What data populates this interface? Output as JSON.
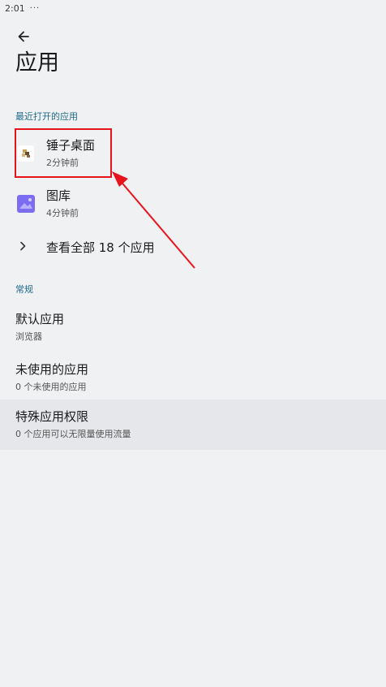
{
  "status_bar": {
    "time": "2:01",
    "more": "···"
  },
  "page": {
    "title": "应用"
  },
  "recent": {
    "header": "最近打开的应用",
    "apps": [
      {
        "name": "锤子桌面",
        "subtitle": "2分钟前",
        "icon": "hammer-launcher-icon"
      },
      {
        "name": "图库",
        "subtitle": "4分钟前",
        "icon": "gallery-icon"
      }
    ],
    "view_all": "查看全部 18 个应用"
  },
  "general": {
    "header": "常规",
    "items": [
      {
        "title": "默认应用",
        "subtitle": "浏览器"
      },
      {
        "title": "未使用的应用",
        "subtitle": "0 个未使用的应用"
      },
      {
        "title": "特殊应用权限",
        "subtitle": "0 个应用可以无限量使用流量"
      }
    ]
  },
  "colors": {
    "background": "#f0f1f3",
    "section_header": "#1f6a8a",
    "annotation": "#e8141b",
    "gallery_icon": "#7b6cf2"
  }
}
